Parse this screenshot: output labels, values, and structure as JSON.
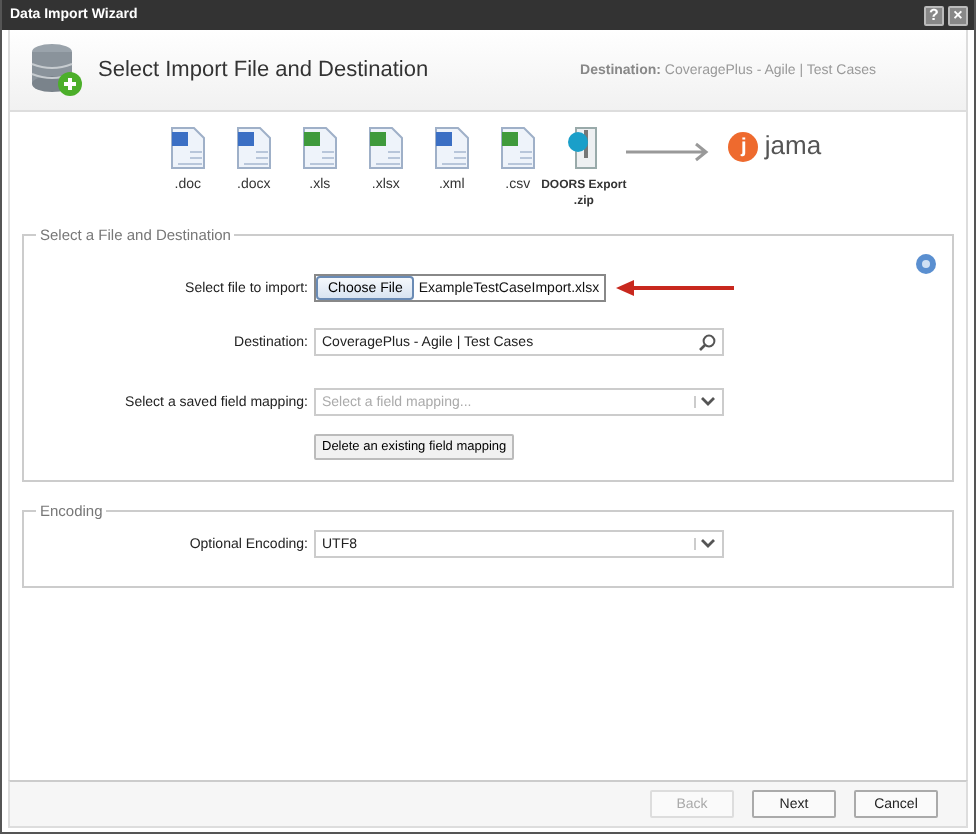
{
  "window": {
    "title": "Data Import Wizard",
    "controls": [
      "?",
      "×"
    ]
  },
  "header": {
    "title": "Select Import File and Destination",
    "destination_label": "Destination:",
    "destination_value": "CoveragePlus - Agile | Test Cases"
  },
  "formats": [
    {
      "kind": "word",
      "label": ".doc"
    },
    {
      "kind": "word",
      "label": ".docx"
    },
    {
      "kind": "excel",
      "label": ".xls"
    },
    {
      "kind": "excel",
      "label": ".xlsx"
    },
    {
      "kind": "word",
      "label": ".xml"
    },
    {
      "kind": "excel",
      "label": ".csv"
    },
    {
      "kind": "zip",
      "label": "DOORS Export\n.zip"
    }
  ],
  "target": {
    "mark": "j",
    "name": "jama"
  },
  "file_section": {
    "legend": "Select a File and Destination",
    "file_label": "Select file to import:",
    "choose_button": "Choose File",
    "file_name": "ExampleTestCaseImport.xlsx",
    "destination_label": "Destination:",
    "destination_value": "CoveragePlus - Agile | Test Cases",
    "mapping_label": "Select a saved field mapping:",
    "mapping_placeholder": "Select a field mapping...",
    "delete_button": "Delete an existing field mapping"
  },
  "encoding_section": {
    "legend": "Encoding",
    "label": "Optional Encoding:",
    "value": "UTF8"
  },
  "buttons": [
    {
      "label": "Back",
      "disabled": true
    },
    {
      "label": "Next",
      "disabled": false
    },
    {
      "label": "Cancel",
      "disabled": false
    }
  ]
}
